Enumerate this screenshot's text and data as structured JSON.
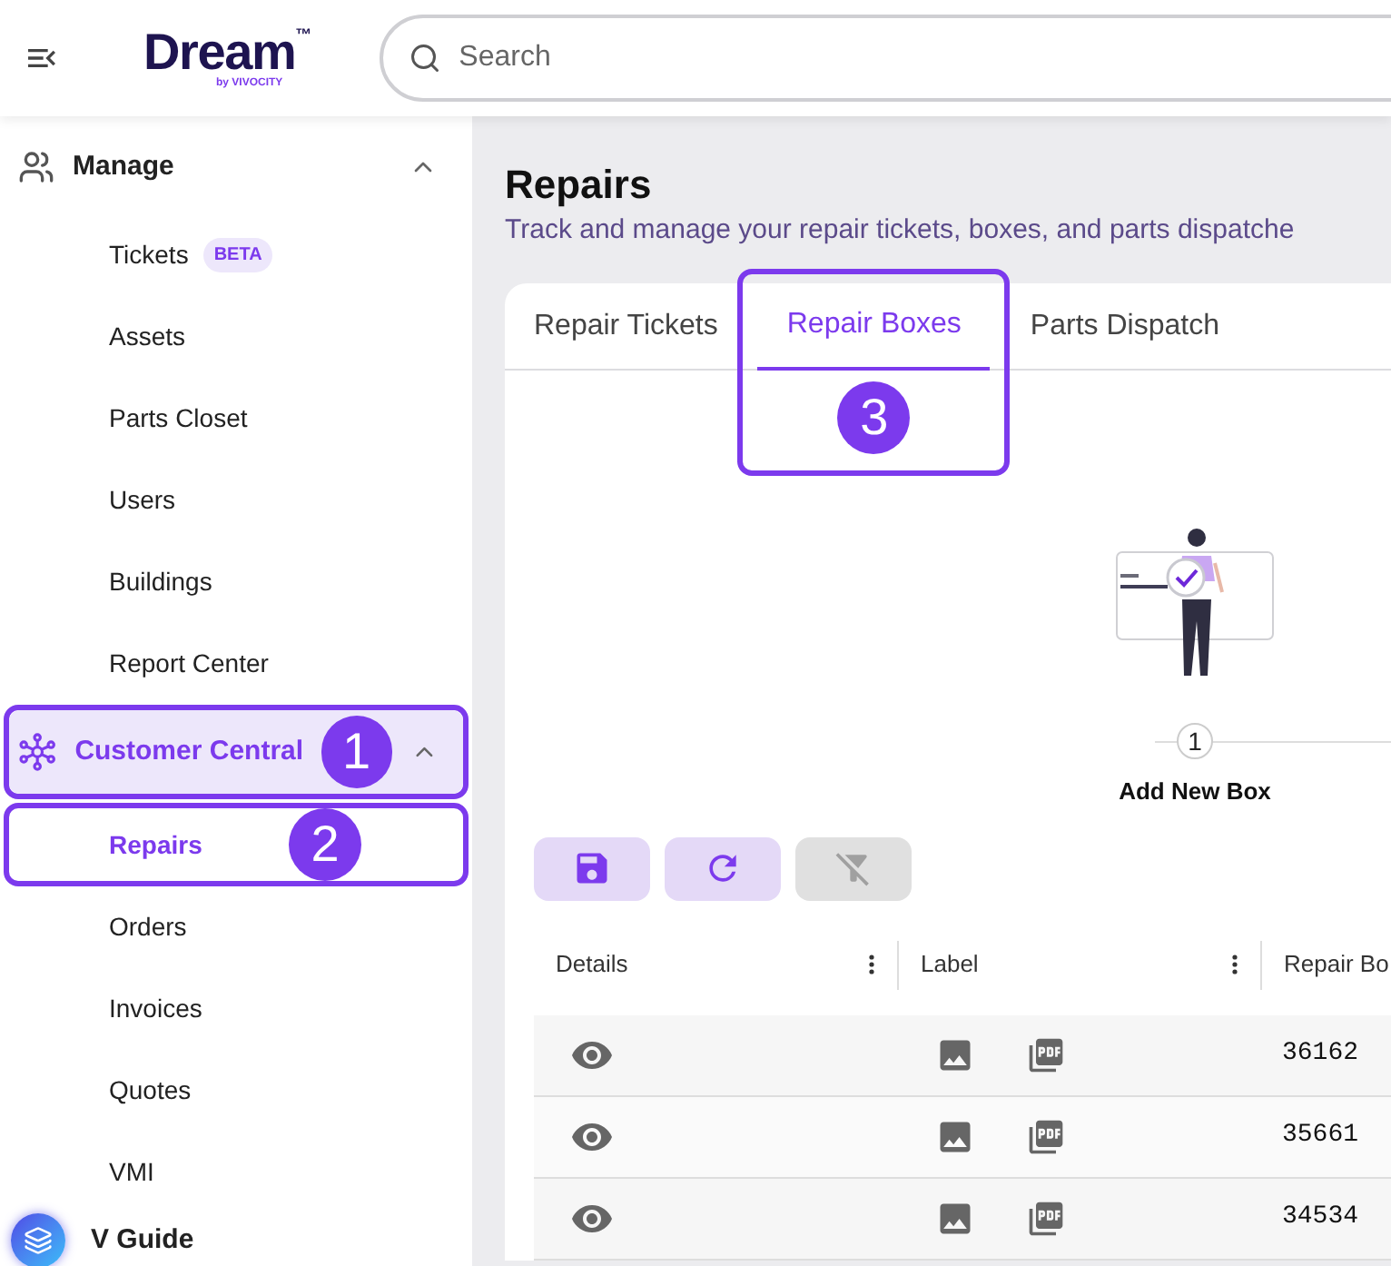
{
  "header": {
    "logo": {
      "name": "Dream",
      "mark": "™",
      "byline": "by VIVOCITY"
    },
    "search": {
      "placeholder": "Search"
    }
  },
  "sidebar": {
    "groups": [
      {
        "kind": "users",
        "label": "Manage",
        "expanded": true,
        "selected": false,
        "items": [
          {
            "label": "Tickets",
            "badge": "BETA",
            "selected": false
          },
          {
            "label": "Assets",
            "selected": false
          },
          {
            "label": "Parts Closet",
            "selected": false
          },
          {
            "label": "Users",
            "selected": false
          },
          {
            "label": "Buildings",
            "selected": false
          },
          {
            "label": "Report Center",
            "selected": false
          }
        ]
      },
      {
        "kind": "hub",
        "label": "Customer Central",
        "expanded": true,
        "selected": true,
        "callout": "1",
        "items": [
          {
            "label": "Repairs",
            "selected": true,
            "callout": "2"
          },
          {
            "label": "Orders",
            "selected": false
          },
          {
            "label": "Invoices",
            "selected": false
          },
          {
            "label": "Quotes",
            "selected": false
          },
          {
            "label": "VMI",
            "selected": false
          }
        ]
      }
    ],
    "footer": {
      "label": "V Guide"
    }
  },
  "page": {
    "title": "Repairs",
    "subtitle": "Track and manage your repair tickets, boxes, and parts dispatche"
  },
  "tabs": [
    {
      "label": "Repair Tickets",
      "selected": false
    },
    {
      "label": "Repair Boxes",
      "selected": true,
      "callout": "3"
    },
    {
      "label": "Parts Dispatch",
      "selected": false
    }
  ],
  "stepper": [
    {
      "number": "1",
      "label": "Add New Box"
    }
  ],
  "toolbar": [
    {
      "kind": "save",
      "disabled": false
    },
    {
      "kind": "refresh",
      "disabled": false
    },
    {
      "kind": "clear-filter",
      "disabled": true
    }
  ],
  "table": {
    "columns": [
      "Details",
      "Label",
      "Repair Bo"
    ],
    "rows": [
      {
        "repair_box": "36162"
      },
      {
        "repair_box": "35661"
      },
      {
        "repair_box": "34534"
      }
    ]
  }
}
